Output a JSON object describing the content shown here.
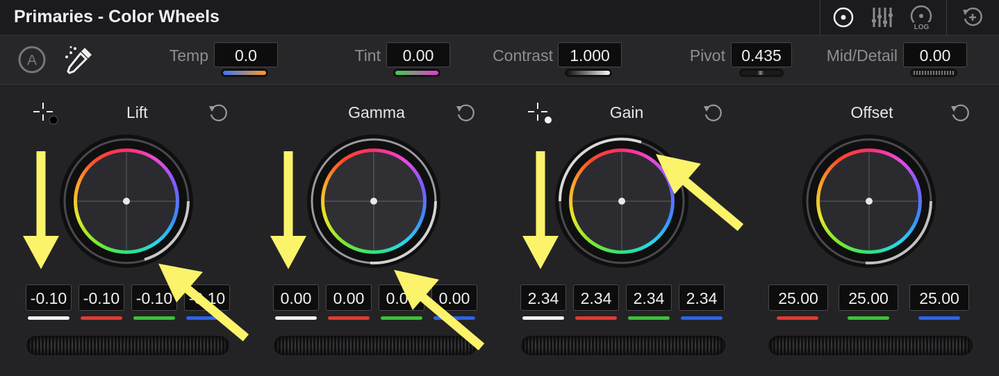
{
  "header": {
    "title": "Primaries - Color Wheels",
    "modes": [
      {
        "icon": "wheels-mode-icon",
        "active": true
      },
      {
        "icon": "bars-mode-icon",
        "active": false
      },
      {
        "icon": "log-mode-icon",
        "label": "LOG",
        "active": false
      },
      {
        "icon": "reset-all-icon",
        "active": false
      }
    ]
  },
  "controls": {
    "auto_label": "A",
    "temp": {
      "label": "Temp",
      "value": "0.0"
    },
    "tint": {
      "label": "Tint",
      "value": "0.00"
    },
    "contrast": {
      "label": "Contrast",
      "value": "1.000"
    },
    "pivot": {
      "label": "Pivot",
      "value": "0.435"
    },
    "mid_detail": {
      "label": "Mid/Detail",
      "value": "0.00"
    }
  },
  "wheels": [
    {
      "name": "Lift",
      "values": [
        "-0.10",
        "-0.10",
        "-0.10",
        "-0.10"
      ]
    },
    {
      "name": "Gamma",
      "values": [
        "0.00",
        "0.00",
        "0.00",
        "0.00"
      ]
    },
    {
      "name": "Gain",
      "values": [
        "2.34",
        "2.34",
        "2.34",
        "2.34"
      ]
    },
    {
      "name": "Offset",
      "values": [
        "25.00",
        "25.00",
        "25.00"
      ]
    }
  ],
  "channel_colors": {
    "y": "#f2f2f2",
    "r": "#e23a32",
    "g": "#3fbf3a",
    "b": "#2e62e8"
  },
  "annotation_color": "#fbf36a"
}
